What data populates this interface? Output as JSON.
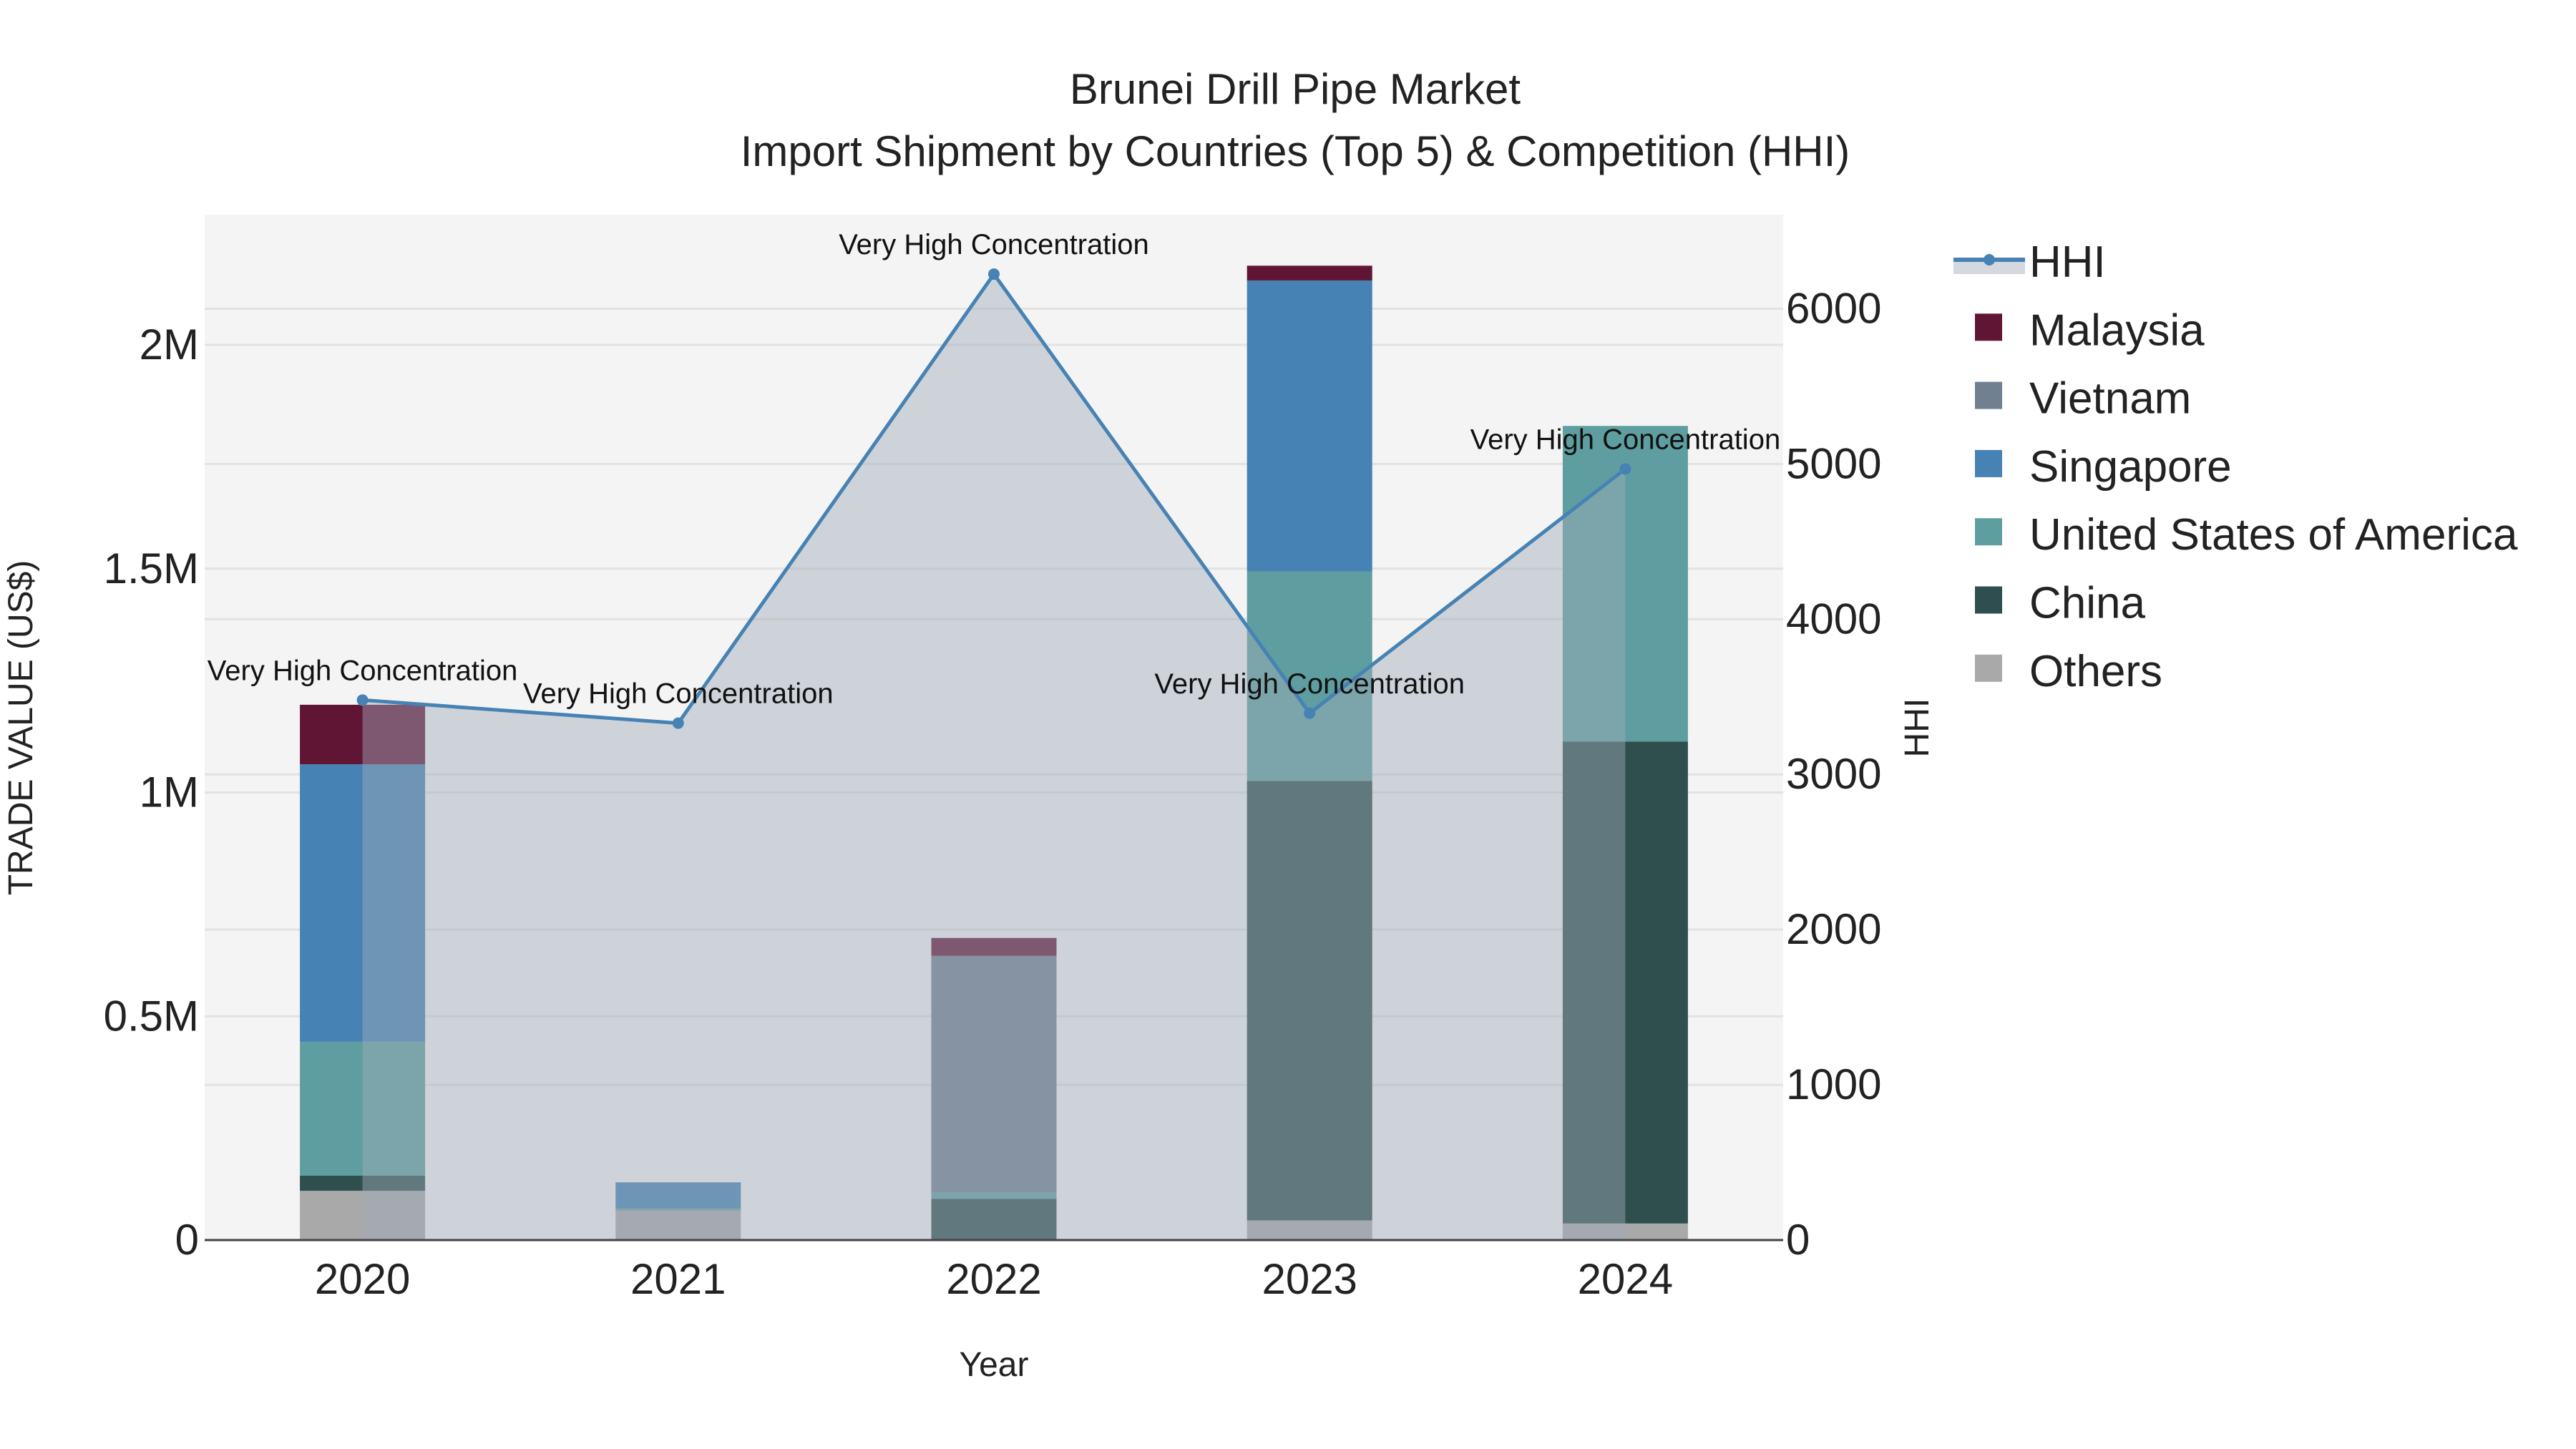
{
  "chart_data": {
    "type": "bar",
    "title": "Brunei Drill Pipe Market",
    "subtitle": "Import Shipment by Countries (Top 5) & Competition (HHI)",
    "xlabel": "Year",
    "ylabel": "TRADE VALUE (US$)",
    "y2label": "HHI",
    "categories": [
      "2020",
      "2021",
      "2022",
      "2023",
      "2024"
    ],
    "ylim": [
      0,
      2291000
    ],
    "y2lim": [
      0,
      6606
    ],
    "yticks": [
      {
        "v": 0,
        "label": "0"
      },
      {
        "v": 500000,
        "label": "0.5M"
      },
      {
        "v": 1000000,
        "label": "1M"
      },
      {
        "v": 1500000,
        "label": "1.5M"
      },
      {
        "v": 2000000,
        "label": "2M"
      }
    ],
    "y2ticks": [
      {
        "v": 0,
        "label": "0"
      },
      {
        "v": 1000,
        "label": "1000"
      },
      {
        "v": 2000,
        "label": "2000"
      },
      {
        "v": 3000,
        "label": "3000"
      },
      {
        "v": 4000,
        "label": "4000"
      },
      {
        "v": 5000,
        "label": "5000"
      },
      {
        "v": 6000,
        "label": "6000"
      }
    ],
    "grid": true,
    "stacked": true,
    "legend_position": "right",
    "series": [
      {
        "name": "Others",
        "color": "#A9A9A9",
        "values": [
          110000,
          66000,
          0,
          44000,
          37000
        ]
      },
      {
        "name": "China",
        "color": "#2F4F4F",
        "values": [
          34000,
          0,
          92000,
          982000,
          1077000
        ]
      },
      {
        "name": "United States of America",
        "color": "#5F9EA0",
        "values": [
          299000,
          5000,
          15000,
          468000,
          705000
        ]
      },
      {
        "name": "Singapore",
        "color": "#4682B4",
        "values": [
          620000,
          58000,
          0,
          650000,
          0
        ]
      },
      {
        "name": "Vietnam",
        "color": "#708090",
        "values": [
          0,
          0,
          528000,
          0,
          0
        ]
      },
      {
        "name": "Malaysia",
        "color": "#611535",
        "values": [
          133000,
          0,
          40000,
          33000,
          0
        ]
      }
    ],
    "hhi": {
      "name": "HHI",
      "color": "#4682B4",
      "values": [
        3479,
        3330,
        6223,
        3394,
        4968
      ],
      "annotations": [
        "Very High Concentration",
        "Very High Concentration",
        "Very High Concentration",
        "Very High Concentration",
        "Very High Concentration"
      ]
    },
    "legend_order": [
      "HHI",
      "Malaysia",
      "Vietnam",
      "Singapore",
      "United States of America",
      "China",
      "Others"
    ]
  }
}
